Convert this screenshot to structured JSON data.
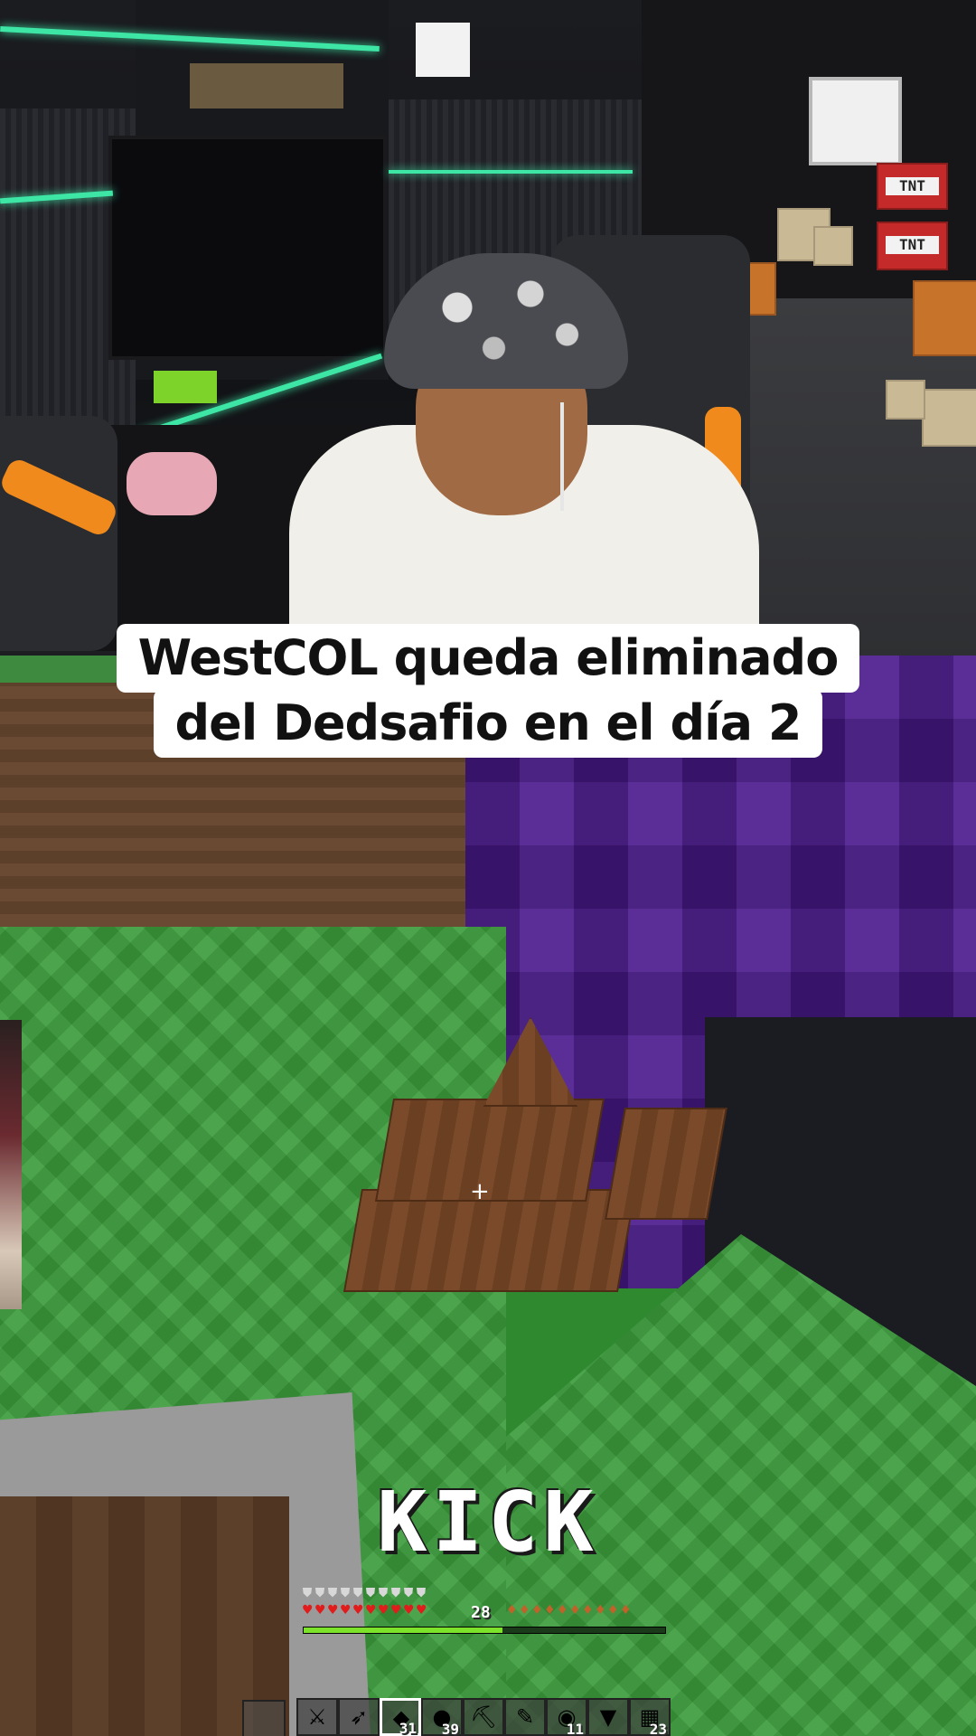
{
  "caption": {
    "line1": "WestCOL queda eliminado",
    "line2": "del Dedsafio en el día 2"
  },
  "watermark": {
    "text": "KICK"
  },
  "hud": {
    "level": "28",
    "hearts_full": 10,
    "armor_full": 10,
    "hunger_full": 10,
    "xp_progress": 0.55,
    "hotbar": [
      {
        "icon": "diamond-sword-icon",
        "glyph": "⚔",
        "count": ""
      },
      {
        "icon": "bow-icon",
        "glyph": "➶",
        "count": ""
      },
      {
        "icon": "golden-carrot-icon",
        "glyph": "◆",
        "count": "31"
      },
      {
        "icon": "potion-icon",
        "glyph": "●",
        "count": "39"
      },
      {
        "icon": "pickaxe-icon",
        "glyph": "⛏",
        "count": ""
      },
      {
        "icon": "axe-icon",
        "glyph": "✎",
        "count": ""
      },
      {
        "icon": "golden-apple-icon",
        "glyph": "◉",
        "count": "11"
      },
      {
        "icon": "bucket-icon",
        "glyph": "▼",
        "count": ""
      },
      {
        "icon": "wood-planks-icon",
        "glyph": "▦",
        "count": "23"
      }
    ],
    "selected_slot": 3
  },
  "colors": {
    "accent_led": "#3ee6a6",
    "caption_bg": "#ffffff",
    "caption_text": "#111111",
    "grass": "#3b9b3b",
    "portal": "#4a1a8c"
  }
}
